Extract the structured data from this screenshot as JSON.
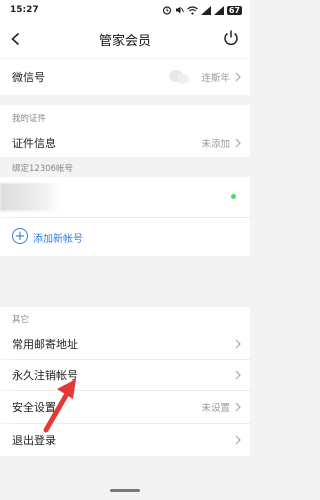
{
  "status_bar": {
    "time": "15:27",
    "battery": "67"
  },
  "nav": {
    "title": "管家会员"
  },
  "wechat": {
    "label": "微信号",
    "value": "连斯年"
  },
  "certificates": {
    "section_title": "我的证件",
    "info_label": "证件信息",
    "info_value": "未添加"
  },
  "accounts": {
    "section_title": "绑定12306帐号",
    "add_label": "添加新帐号",
    "status_color": "#4cd964"
  },
  "other": {
    "section_title": "其它",
    "items": [
      {
        "label": "常用邮寄地址",
        "value": ""
      },
      {
        "label": "永久注销帐号",
        "value": ""
      },
      {
        "label": "安全设置",
        "value": "未设置"
      },
      {
        "label": "退出登录",
        "value": ""
      }
    ]
  },
  "colors": {
    "accent_blue": "#2f7de1",
    "annotation_red": "#e53935"
  }
}
